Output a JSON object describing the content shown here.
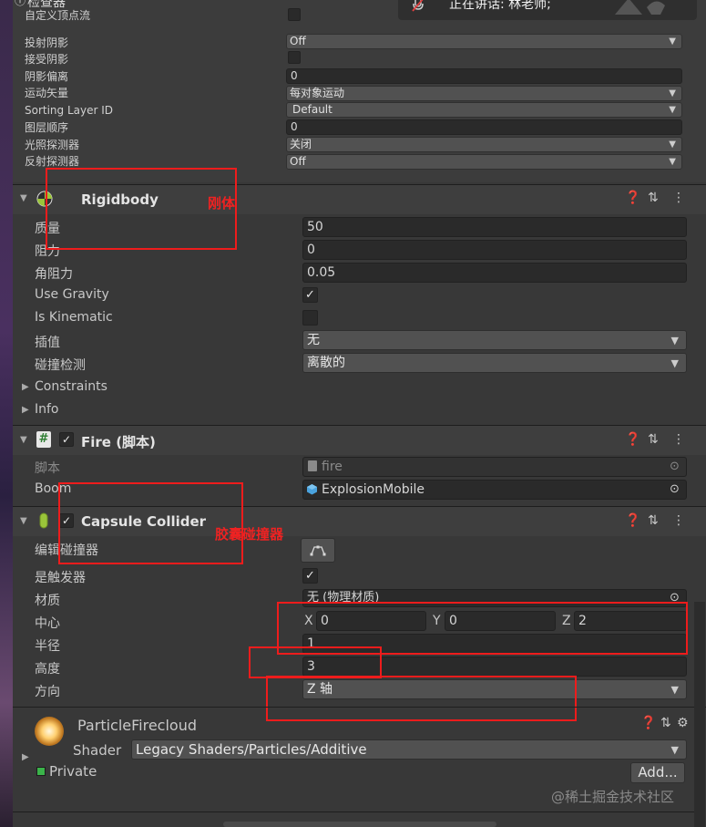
{
  "top": {
    "window_title": "检查器",
    "rows": [
      {
        "label": "自定义顶点流",
        "type": "checkbox"
      },
      {
        "label": "投射阴影",
        "type": "dropdown",
        "value": "Off"
      },
      {
        "label": "接受阴影",
        "type": "checkbox"
      },
      {
        "label": "阴影偏离",
        "type": "field",
        "value": "0"
      },
      {
        "label": "运动矢量",
        "type": "dropdown",
        "value": "每对象运动"
      },
      {
        "label": "Sorting Layer ID",
        "type": "dropdown",
        "value": "Default"
      },
      {
        "label": "图层顺序",
        "type": "field",
        "value": "0"
      },
      {
        "label": "光照探测器",
        "type": "dropdown",
        "value": "关闭"
      },
      {
        "label": "反射探测器",
        "type": "dropdown",
        "value": "Off"
      }
    ]
  },
  "speaker": {
    "text": "正在讲话: 林老师;"
  },
  "rigidbody": {
    "title": "Rigidbody",
    "annotation": "刚体",
    "mass_label": "质量",
    "mass": "50",
    "drag_label": "阻力",
    "drag": "0",
    "angular_drag_label": "角阻力",
    "angular_drag": "0.05",
    "use_gravity_label": "Use Gravity",
    "use_gravity": "✓",
    "is_kinematic_label": "Is Kinematic",
    "interpolate_label": "插值",
    "interpolate": "无",
    "collision_label": "碰撞检测",
    "collision": "离散的",
    "constraints_label": "Constraints",
    "info_label": "Info"
  },
  "fire": {
    "title": "Fire",
    "suffix": "(脚本)",
    "script_label": "脚本",
    "script_value": "fire",
    "boom_label": "Boom",
    "boom_value": "ExplosionMobile"
  },
  "capsule": {
    "title": "Capsule Collider",
    "annotation": "胶囊碰撞器",
    "edit_label": "编辑碰撞器",
    "trigger_label": "是触发器",
    "trigger": "✓",
    "material_label": "材质",
    "material_value": "无 (物理材质)",
    "center_label": "中心",
    "x_label": "X",
    "x": "0",
    "y_label": "Y",
    "y": "0",
    "z_label": "Z",
    "z": "2",
    "radius_label": "半径",
    "radius": "1",
    "height_label": "高度",
    "height": "3",
    "direction_label": "方向",
    "direction": "Z 轴"
  },
  "material": {
    "name": "ParticleFirecloud",
    "shader_label": "Shader",
    "shader_value": "Legacy Shaders/Particles/Additive",
    "private_label": "Private",
    "add_button": "Add..."
  },
  "watermark": "@稀土掘金技术社区",
  "colors": {
    "annotation_red": "#ee1c1c",
    "panel": "#383838",
    "header": "#3e3e3e",
    "field": "#2a2a2a"
  }
}
